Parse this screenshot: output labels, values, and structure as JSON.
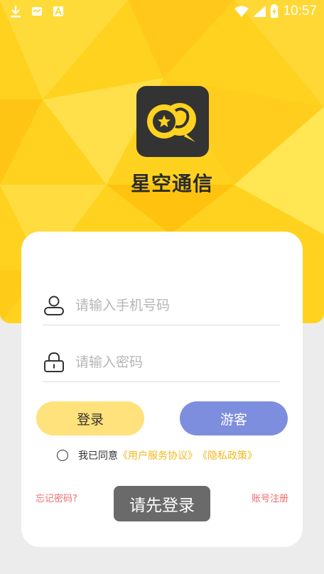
{
  "statusbar": {
    "time": "10:57",
    "icons": [
      "download-icon",
      "notification-icon",
      "a-icon",
      "wifi-icon",
      "signal-icon",
      "battery-charging-icon"
    ]
  },
  "app": {
    "name": "星空通信",
    "logo_icon": "chat-bubbles-star-icon"
  },
  "form": {
    "phone_placeholder": "请输入手机号码",
    "phone_value": "",
    "password_placeholder": "请输入密码",
    "password_value": "",
    "login_label": "登录",
    "guest_label": "游客"
  },
  "agreement": {
    "prefix": "我已同意",
    "user_agreement": "《用户服务协议》",
    "privacy_policy": "《隐私政策》",
    "checked": false
  },
  "links": {
    "forgot_password": "忘记密码?",
    "register": "账号注册"
  },
  "toast": {
    "message": "请先登录"
  },
  "colors": {
    "hero": "#ffd21f",
    "login_button": "#ffe27c",
    "guest_button": "#7e8ede",
    "link_yellow": "#f1b91f",
    "link_red": "#f06a6a"
  }
}
